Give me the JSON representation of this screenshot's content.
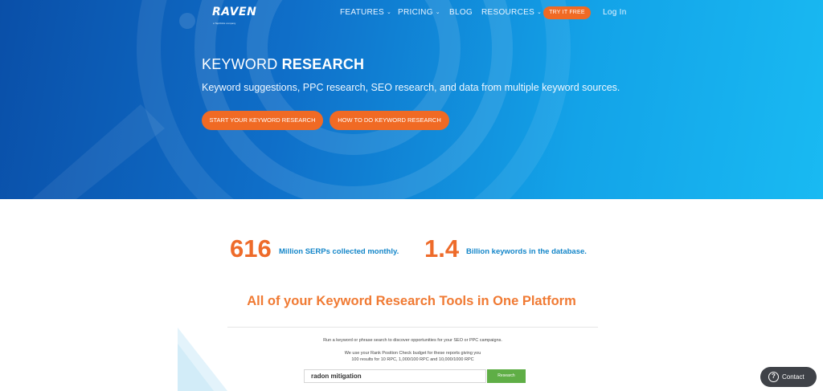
{
  "logo": {
    "text": "RAVEN",
    "subtext": "a TapClicks company"
  },
  "nav": {
    "features": "FEATURES",
    "pricing": "PRICING",
    "blog": "BLOG",
    "resources": "RESOURCES",
    "try_free": "TRY IT FREE",
    "login": "Log In"
  },
  "hero": {
    "title_light": "KEYWORD",
    "title_bold": "RESEARCH",
    "subtitle": "Keyword suggestions, PPC research, SEO research, and data from multiple keyword sources.",
    "cta_start": "START YOUR KEYWORD RESEARCH",
    "cta_howto": "HOW TO DO KEYWORD RESEARCH"
  },
  "stats": [
    {
      "number": "616",
      "label": "Million SERPs collected monthly."
    },
    {
      "number": "1.4",
      "label": "Billion keywords in the database."
    }
  ],
  "section": {
    "title": "All of your Keyword Research Tools in One Platform"
  },
  "demo": {
    "line1": "Run a keyword or phrase search to discover opportunities for your SEO or PPC campaigns.",
    "line2": "We use your Rank Position Check budget for these reports giving you",
    "line3": "100 results for 10 RPC, 1,000/100 RPC and 10,000/1000 RPC",
    "input_value": "radon mitigation",
    "button": "Research"
  },
  "contact": {
    "label": "Contact",
    "icon": "question-icon"
  },
  "colors": {
    "accent": "#f06a24",
    "stat_label": "#1486c9",
    "hero_start": "#0a4fa8",
    "hero_end": "#19baf2",
    "research_button": "#5fae46"
  }
}
